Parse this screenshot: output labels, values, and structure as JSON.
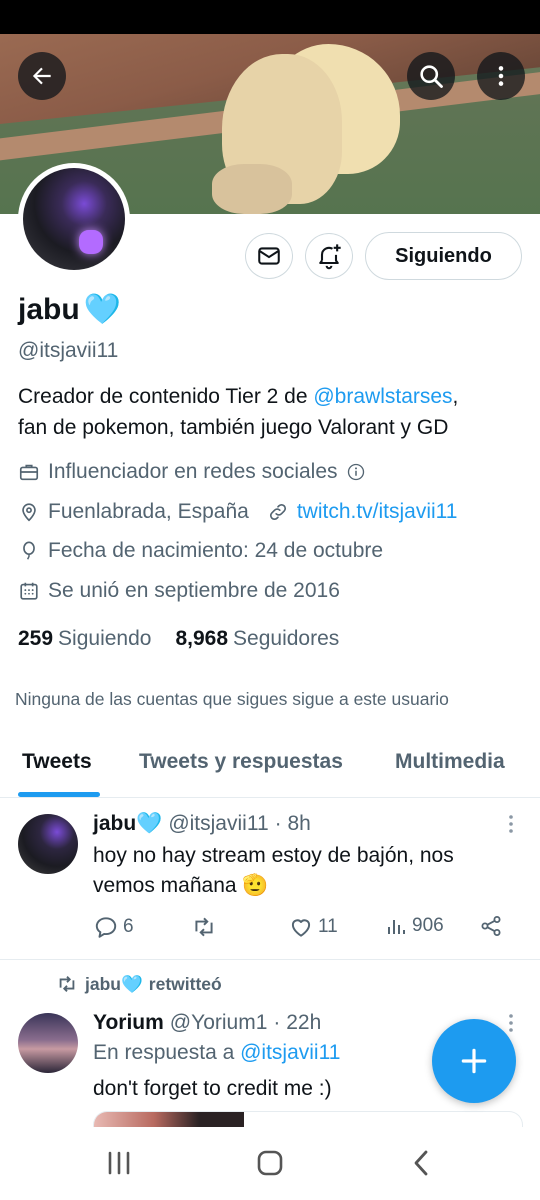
{
  "profile": {
    "name": "jabu",
    "name_emoji": "🩵",
    "handle": "@itsjavii11",
    "bio_prefix": "Creador de contenido Tier 2 de ",
    "bio_mention": "@brawlstarses",
    "bio_suffix": ",",
    "bio_line2": "fan de pokemon, también juego Valorant y GD",
    "category": "Influenciador en redes sociales",
    "location": "Fuenlabrada, España",
    "website": "twitch.tv/itsjavii11",
    "birthday": "Fecha de nacimiento: 24 de octubre",
    "joined": "Se unió en septiembre de 2016",
    "following_count": "259",
    "following_label": "Siguiendo",
    "followers_count": "8,968",
    "followers_label": "Seguidores",
    "mutual_note": "Ninguna de las cuentas que sigues sigue a este usuario",
    "follow_button": "Siguiendo"
  },
  "tabs": [
    {
      "label": "Tweets",
      "active": true
    },
    {
      "label": "Tweets y respuestas",
      "active": false
    },
    {
      "label": "Multimedia",
      "active": false
    }
  ],
  "tweets": [
    {
      "name": "jabu",
      "name_emoji": "🩵",
      "handle": "@itsjavii11",
      "time": "· 8h",
      "text": "hoy no hay stream estoy de bajón, nos vemos mañana 🫡",
      "replies": "6",
      "retweets": "",
      "likes": "11",
      "views": "906"
    },
    {
      "retweeted_by": "jabu",
      "retweeted_by_emoji": "🩵",
      "retweeted_label": "retwitteó",
      "name": "Yorium",
      "handle": "@Yorium1",
      "time": "· 22h",
      "reply_prefix": "En respuesta a ",
      "reply_to": "@itsjavii11",
      "text": "don't forget to credit me :)"
    }
  ],
  "colors": {
    "accent": "#1d9bf0",
    "text": "#0f1419",
    "muted": "#536471",
    "border": "#cfd9de"
  }
}
